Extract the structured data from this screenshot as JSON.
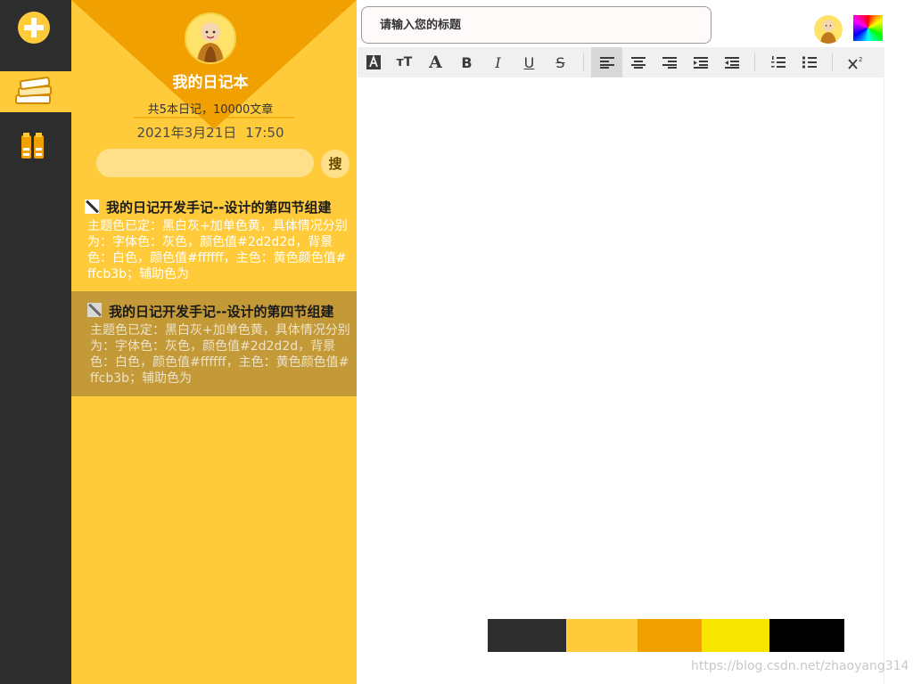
{
  "sidebar": {
    "book_title": "我的日记本",
    "stats": "共5本日记，10000文章",
    "date": "2021年3月21日",
    "time": "17:50",
    "search_placeholder": "",
    "search_label": "搜"
  },
  "entries": [
    {
      "title": "我的日记开发手记--设计的第四节组建",
      "body": "主题色已定：黑白灰+加单色黄，具体情况分别为：字体色：灰色，颜色值#2d2d2d，背景色：白色，颜色值#ffffff，主色：黄色颜色值#ffcb3b；辅助色为"
    },
    {
      "title": "我的日记开发手记--设计的第四节组建",
      "body": "主题色已定：黑白灰+加单色黄，具体情况分别为：字体色：灰色，颜色值#2d2d2d，背景色：白色，颜色值#ffffff，主色：黄色颜色值#ffcb3b；辅助色为"
    }
  ],
  "editor": {
    "title_placeholder": "请输入您的标题",
    "toolbar_glyphs": {
      "font-color": "A",
      "font-size": "тT",
      "font-family": "A",
      "bold": "B",
      "italic": "I",
      "underline": "U",
      "strikethrough": "S"
    }
  },
  "swatches": [
    {
      "color": "#2d2d2d",
      "width_share": 0.22
    },
    {
      "color": "#ffcb3b",
      "width_share": 0.2
    },
    {
      "color": "#f0a000",
      "width_share": 0.18
    },
    {
      "color": "#f7e600",
      "width_share": 0.19
    },
    {
      "color": "#000000",
      "width_share": 0.21
    }
  ],
  "watermark": "https://blog.csdn.net/zhaoyang314",
  "colors": {
    "rail": "#2d2d2d",
    "accent": "#ffcb3b",
    "accent_dark": "#f0a000",
    "selected_entry": "#c49a38"
  }
}
